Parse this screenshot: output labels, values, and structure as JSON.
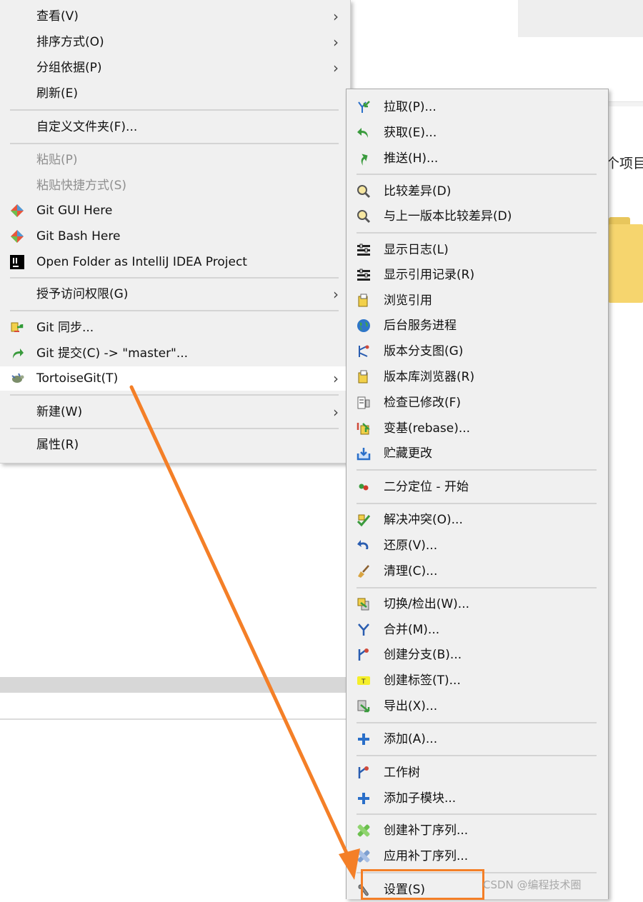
{
  "background": {
    "item_label": "个项目"
  },
  "left_menu": {
    "items": [
      {
        "label": "查看(V)",
        "submenu": true
      },
      {
        "label": "排序方式(O)",
        "submenu": true
      },
      {
        "label": "分组依据(P)",
        "submenu": true
      },
      {
        "label": "刷新(E)"
      },
      {
        "label": "自定义文件夹(F)..."
      },
      {
        "label": "粘贴(P)",
        "disabled": true
      },
      {
        "label": "粘贴快捷方式(S)",
        "disabled": true
      },
      {
        "label": "Git GUI Here",
        "icon": "git-diamond-icon"
      },
      {
        "label": "Git Bash Here",
        "icon": "git-diamond-icon"
      },
      {
        "label": "Open Folder as IntelliJ IDEA Project",
        "icon": "intellij-icon"
      },
      {
        "label": "授予访问权限(G)",
        "submenu": true
      },
      {
        "label": "Git 同步...",
        "icon": "git-sync-icon"
      },
      {
        "label": "Git 提交(C) -> \"master\"...",
        "icon": "git-commit-icon"
      },
      {
        "label": "TortoiseGit(T)",
        "icon": "tortoisegit-icon",
        "submenu": true,
        "highlighted": true
      },
      {
        "label": "新建(W)",
        "submenu": true
      },
      {
        "label": "属性(R)"
      }
    ]
  },
  "right_menu": {
    "items": [
      {
        "label": "拉取(P)...",
        "icon": "pull-icon"
      },
      {
        "label": "获取(E)...",
        "icon": "fetch-icon"
      },
      {
        "label": "推送(H)...",
        "icon": "push-icon"
      },
      {
        "label": "比较差异(D)",
        "icon": "diff-icon"
      },
      {
        "label": "与上一版本比较差异(D)",
        "icon": "diff-previous-icon"
      },
      {
        "label": "显示日志(L)",
        "icon": "log-icon"
      },
      {
        "label": "显示引用记录(R)",
        "icon": "reflog-icon"
      },
      {
        "label": "浏览引用",
        "icon": "browse-references-icon"
      },
      {
        "label": "后台服务进程",
        "icon": "daemon-globe-icon"
      },
      {
        "label": "版本分支图(G)",
        "icon": "revision-graph-icon"
      },
      {
        "label": "版本库浏览器(R)",
        "icon": "repo-browser-icon"
      },
      {
        "label": "检查已修改(F)",
        "icon": "check-modifications-icon"
      },
      {
        "label": "变基(rebase)...",
        "icon": "rebase-icon"
      },
      {
        "label": "贮藏更改",
        "icon": "stash-icon"
      },
      {
        "label": "二分定位 - 开始",
        "icon": "bisect-icon"
      },
      {
        "label": "解决冲突(O)...",
        "icon": "resolve-icon"
      },
      {
        "label": "还原(V)...",
        "icon": "revert-icon"
      },
      {
        "label": "清理(C)...",
        "icon": "cleanup-broom-icon"
      },
      {
        "label": "切换/检出(W)...",
        "icon": "switch-checkout-icon"
      },
      {
        "label": "合并(M)...",
        "icon": "merge-icon"
      },
      {
        "label": "创建分支(B)...",
        "icon": "create-branch-icon"
      },
      {
        "label": "创建标签(T)...",
        "icon": "create-tag-icon"
      },
      {
        "label": "导出(X)...",
        "icon": "export-icon"
      },
      {
        "label": "添加(A)...",
        "icon": "add-plus-icon"
      },
      {
        "label": "工作树",
        "icon": "worktree-icon"
      },
      {
        "label": "添加子模块...",
        "icon": "add-submodule-plus-icon"
      },
      {
        "label": "创建补丁序列...",
        "icon": "create-patch-icon"
      },
      {
        "label": "应用补丁序列...",
        "icon": "apply-patch-icon"
      },
      {
        "label": "设置(S)",
        "icon": "settings-icon",
        "annotated": true
      }
    ]
  },
  "annotation": {
    "color": "#f47f27",
    "watermark": "CSDN @编程技术圈"
  }
}
